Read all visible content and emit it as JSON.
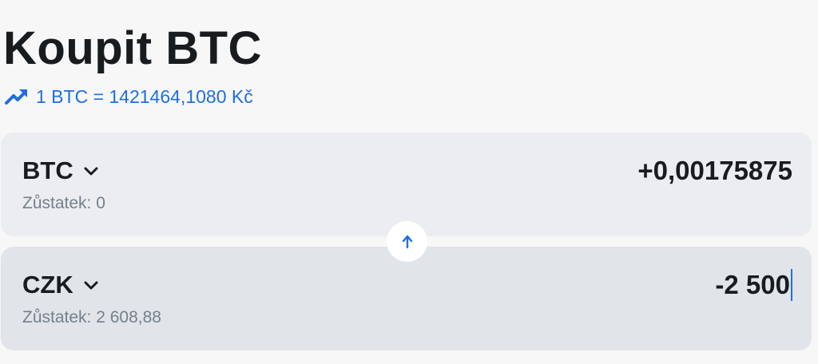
{
  "header": {
    "title": "Koupit BTC",
    "rate_text": "1 BTC = 1421464,1080 Kč"
  },
  "from_card": {
    "currency": "BTC",
    "balance": "Zůstatek: 0",
    "amount": "+0,00175875"
  },
  "to_card": {
    "currency": "CZK",
    "balance": "Zůstatek: 2 608,88",
    "amount": "-2 500"
  },
  "icons": {
    "rate": "trending-up-icon",
    "currency_select": "chevron-down-icon",
    "swap": "arrow-up-icon"
  },
  "colors": {
    "accent": "#1f6fe0",
    "text": "#191c1f",
    "muted": "#75808a",
    "card_top": "#ebedf1",
    "card_bottom": "#e1e4e9",
    "background": "#f7f7f8"
  }
}
